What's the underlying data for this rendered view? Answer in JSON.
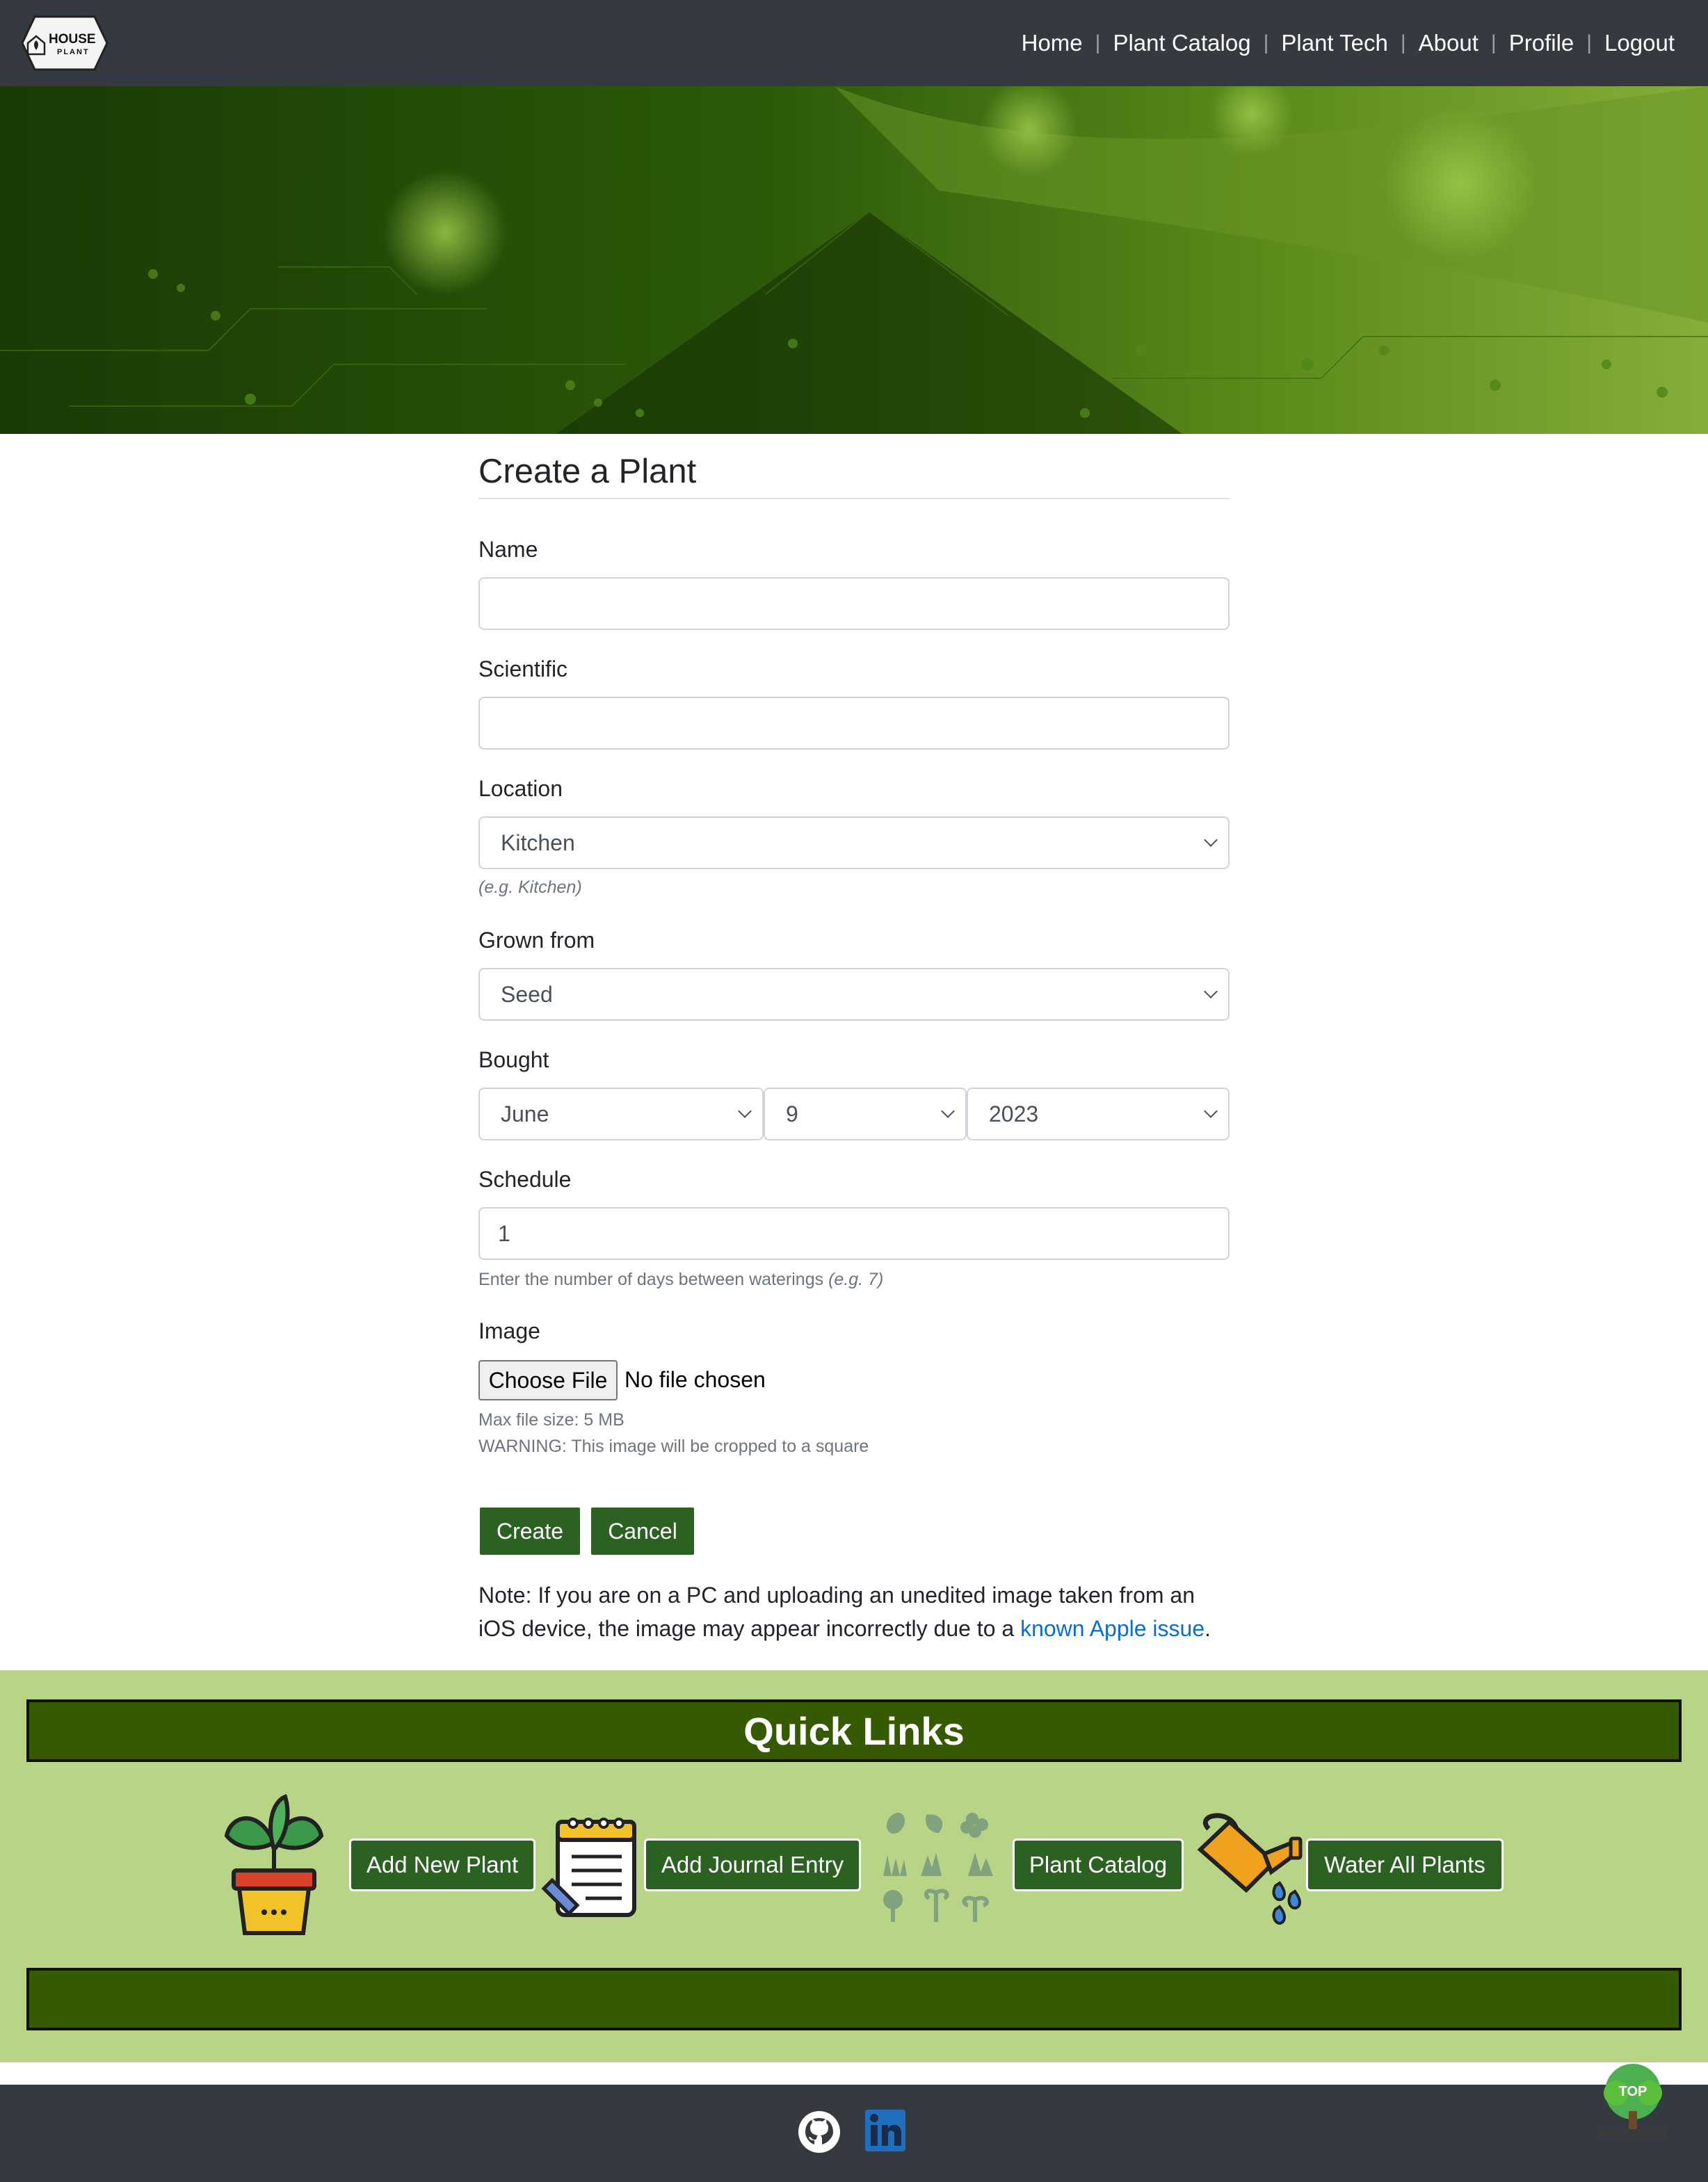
{
  "navbar": {
    "logo_text_top": "HOUSE",
    "logo_text_bottom": "PLANT",
    "links": [
      "Home",
      "Plant Catalog",
      "Plant Tech",
      "About",
      "Profile",
      "Logout"
    ],
    "separator": "|"
  },
  "form": {
    "title": "Create a Plant",
    "name_label": "Name",
    "name_value": "",
    "scientific_label": "Scientific",
    "scientific_value": "",
    "location_label": "Location",
    "location_value": "Kitchen",
    "location_hint": "(e.g. Kitchen)",
    "grown_from_label": "Grown from",
    "grown_from_value": "Seed",
    "bought_label": "Bought",
    "bought_month": "June",
    "bought_day": "9",
    "bought_year": "2023",
    "schedule_label": "Schedule",
    "schedule_value": "1",
    "schedule_hint_text": "Enter the number of days between waterings",
    "schedule_hint_example": "(e.g. 7)",
    "image_label": "Image",
    "choose_file_label": "Choose File",
    "file_status": "No file chosen",
    "max_size_hint": "Max file size: 5 MB",
    "crop_warning": "WARNING: This image will be cropped to a square",
    "create_button": "Create",
    "cancel_button": "Cancel",
    "note_text": "Note: If you are on a PC and uploading an unedited image taken from an iOS device, the image may appear incorrectly due to a",
    "note_link": "known Apple issue",
    "note_end": "."
  },
  "quick_links": {
    "title": "Quick Links",
    "buttons": [
      "Add New Plant",
      "Add Journal Entry",
      "Plant Catalog",
      "Water All Plants"
    ],
    "icons": [
      "potted-plant-icon",
      "notepad-pencil-icon",
      "plant-types-icon",
      "watering-can-icon"
    ]
  },
  "footer": {
    "icons": [
      "github-icon",
      "linkedin-icon"
    ],
    "top_label": "TOP"
  },
  "colors": {
    "navbar": "#343a40",
    "button_green": "#2b6222",
    "quick_links_bg": "#b8d587",
    "quick_links_bar": "#355a00",
    "link_blue": "#0a6ed1"
  }
}
